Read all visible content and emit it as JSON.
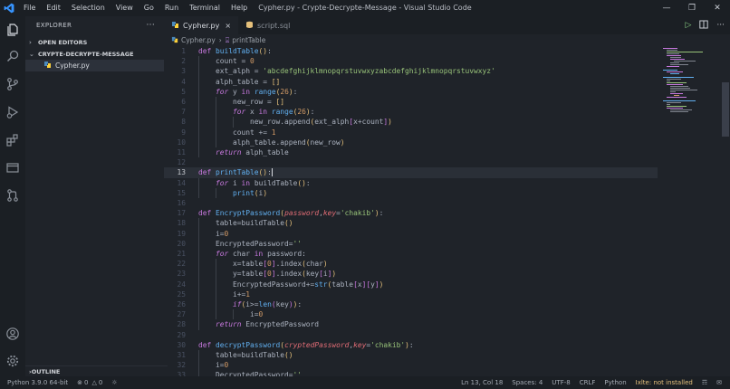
{
  "window": {
    "title": "Cypher.py - Crypte-Decrypte-Message - Visual Studio Code",
    "menu": [
      "File",
      "Edit",
      "Selection",
      "View",
      "Go",
      "Run",
      "Terminal",
      "Help"
    ]
  },
  "sidebar": {
    "header": "EXPLORER",
    "more": "···",
    "open_editors": "OPEN EDITORS",
    "project": "CRYPTE-DECRYPTE-MESSAGE",
    "files": [
      "Cypher.py"
    ],
    "outline": "OUTLINE"
  },
  "tabs": [
    {
      "label": "Cypher.py",
      "close": "×"
    },
    {
      "label": "script.sql"
    }
  ],
  "breadcrumb": {
    "file": "Cypher.py",
    "separator": "›",
    "symbol": "printTable"
  },
  "editor": {
    "line_numbers": [
      "1",
      "2",
      "3",
      "4",
      "5",
      "6",
      "7",
      "8",
      "9",
      "10",
      "11",
      "12",
      "13",
      "14",
      "15",
      "16",
      "17",
      "18",
      "19",
      "20",
      "21",
      "22",
      "23",
      "24",
      "25",
      "26",
      "27",
      "28",
      "29",
      "30",
      "31",
      "32",
      "33"
    ],
    "current_line": "13"
  },
  "statusbar": {
    "interpreter": "Python 3.9.0 64-bit",
    "errors": "0",
    "warnings": "0",
    "position": "Ln 13, Col 18",
    "spaces": "Spaces: 4",
    "encoding": "UTF-8",
    "eol": "CRLF",
    "language": "Python",
    "lint_warning": "Ixlte: not installed"
  },
  "colors": {
    "accent": "#3794ff",
    "keyword": "#c678dd",
    "function": "#61afef",
    "string": "#98c379",
    "number": "#d19a66"
  },
  "icons": [
    "vscode-logo-icon",
    "files-icon",
    "search-icon",
    "source-control-icon",
    "run-debug-icon",
    "extensions-icon",
    "remote-explorer-icon",
    "git-graph-icon",
    "account-icon",
    "settings-gear-icon",
    "run-icon",
    "split-editor-icon",
    "more-actions-icon",
    "python-file-icon",
    "database-file-icon"
  ]
}
